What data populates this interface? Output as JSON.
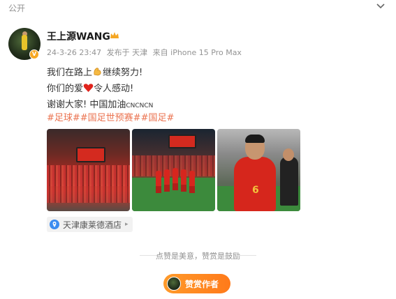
{
  "header": {
    "visibility": "公开"
  },
  "author": {
    "name": "王上源WANG",
    "avatar": "avatar-photo",
    "verified_badge": "v-badge"
  },
  "meta": {
    "time": "24-3-26 23:47",
    "from": "发布于 天津",
    "device": "来自 iPhone 15 Pro Max"
  },
  "post": {
    "line1": "我们在路上",
    "line1_after": "继续努力!",
    "line2": "你们的爱",
    "line2_after": "令人感动!",
    "line3": "谢谢大家!  中国加油",
    "line3_small": "CNCNCN",
    "hashtags": "#足球##国足世预赛##国足#"
  },
  "photos": [
    {
      "name": "stadium-crowd-photo",
      "watermark": ""
    },
    {
      "name": "team-celebration-photo",
      "watermark": ""
    },
    {
      "name": "player-applause-photo",
      "watermark": ""
    }
  ],
  "location": {
    "label": "天津康莱德酒店",
    "icon": "location-pin-icon"
  },
  "praise": {
    "text": "点赞是美意，赞赏是鼓励"
  },
  "reward_button": {
    "label": "赞赏作者"
  },
  "colors": {
    "accent": "#eb7350",
    "reward": "#ff8c22",
    "meta": "#939393"
  }
}
